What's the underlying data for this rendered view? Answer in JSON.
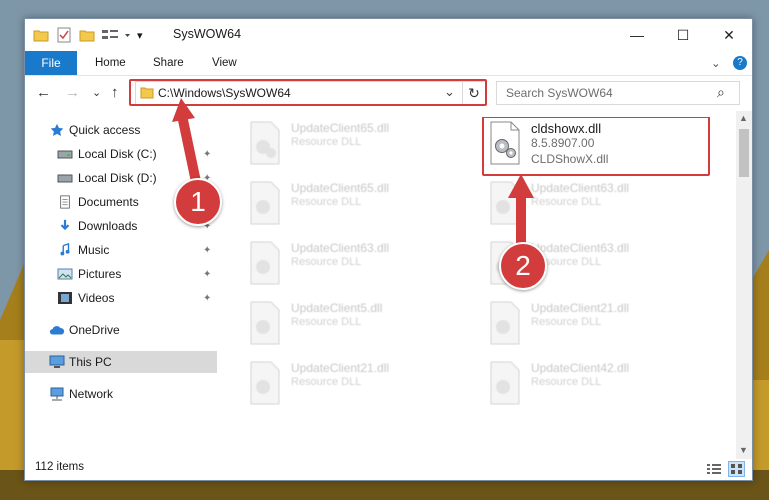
{
  "window": {
    "title": "SysWOW64",
    "controls": {
      "minimize": "—",
      "maximize": "☐",
      "close": "✕"
    }
  },
  "ribbon": {
    "tabs": [
      "File",
      "Home",
      "Share",
      "View"
    ],
    "help_chevron": "⌄",
    "help_icon": "?"
  },
  "nav": {
    "back": "←",
    "forward": "→",
    "recent": "⌄",
    "up": "↑",
    "address": "C:\\Windows\\SysWOW64",
    "address_dropdown": "⌄",
    "refresh": "↻",
    "search_placeholder": "Search SysWOW64",
    "search_icon": "⌕"
  },
  "sidebar": {
    "items": [
      {
        "label": "Quick access",
        "icon": "star-icon",
        "pinned": false
      },
      {
        "label": "Local Disk (C:)",
        "icon": "drive-icon",
        "pinned": true
      },
      {
        "label": "Local Disk (D:)",
        "icon": "drive-icon",
        "pinned": true
      },
      {
        "label": "Documents",
        "icon": "documents-icon",
        "pinned": true
      },
      {
        "label": "Downloads",
        "icon": "download-icon",
        "pinned": true
      },
      {
        "label": "Music",
        "icon": "music-icon",
        "pinned": true
      },
      {
        "label": "Pictures",
        "icon": "pictures-icon",
        "pinned": true
      },
      {
        "label": "Videos",
        "icon": "videos-icon",
        "pinned": true
      },
      {
        "label": "OneDrive",
        "icon": "cloud-icon",
        "pinned": false
      },
      {
        "label": "This PC",
        "icon": "pc-icon",
        "pinned": false
      },
      {
        "label": "Network",
        "icon": "network-icon",
        "pinned": false
      }
    ],
    "pin_glyph": "📌"
  },
  "files": [
    {
      "name": "UpdateClient65.dll",
      "type": "Resource DLL"
    },
    {
      "name": "cldshowx.dll",
      "version": "8.5.8907.00",
      "description": "CLDShowX.dll"
    },
    {
      "name": "UpdateClient65.dll",
      "type": "Resource DLL"
    },
    {
      "name": "UpdateClient63.dll",
      "type": "Resource DLL"
    },
    {
      "name": "UpdateClient63.dll",
      "type": "Resource DLL"
    },
    {
      "name": "UpdateClient63.dll",
      "type": "Resource DLL"
    },
    {
      "name": "UpdateClient5.dll",
      "type": "Resource DLL"
    },
    {
      "name": "UpdateClient21.dll",
      "type": "Resource DLL"
    },
    {
      "name": "UpdateClient21.dll",
      "type": "Resource DLL"
    },
    {
      "name": "UpdateClient42.dll",
      "type": "Resource DLL"
    }
  ],
  "status": {
    "item_count": "112 items"
  },
  "annotations": {
    "badge1": "1",
    "badge2": "2"
  },
  "colors": {
    "accent": "#1979ca",
    "highlight": "#d23c3c",
    "selected": "#d9d9d9"
  }
}
